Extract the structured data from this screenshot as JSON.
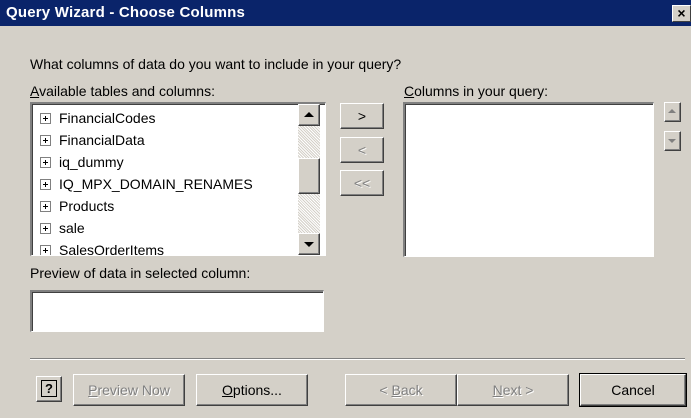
{
  "window": {
    "title": "Query Wizard - Choose Columns",
    "close_glyph": "×"
  },
  "prompt": "What columns of data do you want to include in your query?",
  "available": {
    "label_access": "A",
    "label_rest": "vailable tables and columns:",
    "items": [
      {
        "label": "FinancialCodes"
      },
      {
        "label": "FinancialData"
      },
      {
        "label": "iq_dummy"
      },
      {
        "label": "IQ_MPX_DOMAIN_RENAMES"
      },
      {
        "label": "Products"
      },
      {
        "label": "sale"
      },
      {
        "label": "SalesOrderItems"
      }
    ]
  },
  "move_buttons": {
    "add": ">",
    "remove": "<",
    "remove_all": "<<"
  },
  "columns": {
    "label_access": "C",
    "label_rest": "olumns in your query:"
  },
  "preview": {
    "label": "Preview of data in selected column:",
    "value": ""
  },
  "footer": {
    "help": "?",
    "preview_access": "P",
    "preview_rest": "review Now",
    "options_access": "O",
    "options_rest": "ptions...",
    "back_pre": "< ",
    "back_access": "B",
    "back_rest": "ack",
    "next_access": "N",
    "next_rest": "ext >",
    "cancel": "Cancel"
  },
  "colors": {
    "title_bar": "#0a246a",
    "face": "#d4d0c8"
  },
  "icons": [
    "plus-box-icon",
    "scroll-up-arrow-icon",
    "scroll-down-arrow-icon",
    "help-icon",
    "close-icon"
  ]
}
